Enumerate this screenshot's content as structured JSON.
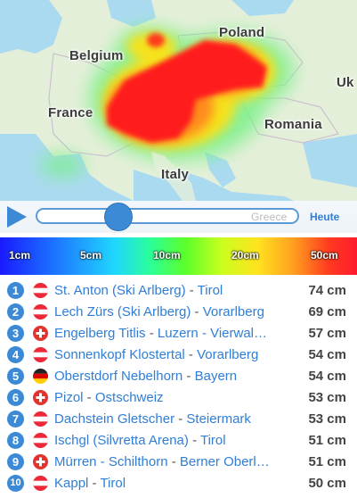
{
  "map": {
    "labels": {
      "poland": "Poland",
      "belgium": "Belgium",
      "uk": "Uk",
      "france": "France",
      "romania": "Romania",
      "italy": "Italy",
      "greece": "Greece"
    }
  },
  "timeline": {
    "today_label": "Heute",
    "slider_position": 0.3
  },
  "legend": {
    "labels": [
      "1cm",
      "5cm",
      "10cm",
      "20cm",
      "50cm"
    ]
  },
  "ranking": [
    {
      "rank": "1",
      "flag": "austria",
      "resort": "St. Anton (Ski Arlberg)",
      "region": "Tirol",
      "depth": "74 cm"
    },
    {
      "rank": "2",
      "flag": "austria",
      "resort": "Lech Zürs (Ski Arlberg)",
      "region": "Vorarlberg",
      "depth": "69 cm"
    },
    {
      "rank": "3",
      "flag": "switzerland",
      "resort": "Engelberg Titlis",
      "region": "Luzern - Vierwal…",
      "depth": "57 cm"
    },
    {
      "rank": "4",
      "flag": "austria",
      "resort": "Sonnenkopf Klostertal",
      "region": "Vorarlberg",
      "depth": "54 cm"
    },
    {
      "rank": "5",
      "flag": "germany",
      "resort": "Oberstdorf Nebelhorn",
      "region": "Bayern",
      "depth": "54 cm"
    },
    {
      "rank": "6",
      "flag": "switzerland",
      "resort": "Pizol",
      "region": "Ostschweiz",
      "depth": "53 cm"
    },
    {
      "rank": "7",
      "flag": "austria",
      "resort": "Dachstein Gletscher",
      "region": "Steiermark",
      "depth": "53 cm"
    },
    {
      "rank": "8",
      "flag": "austria",
      "resort": "Ischgl (Silvretta Arena)",
      "region": "Tirol",
      "depth": "51 cm"
    },
    {
      "rank": "9",
      "flag": "switzerland",
      "resort": "Mürren - Schilthorn",
      "region": "Berner Oberl…",
      "depth": "51 cm"
    },
    {
      "rank": "10",
      "flag": "austria",
      "resort": "Kappl",
      "region": "Tirol",
      "depth": "50 cm"
    }
  ]
}
